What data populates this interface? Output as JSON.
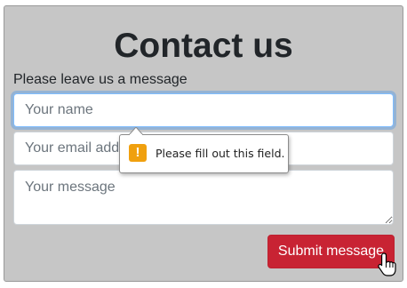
{
  "form": {
    "title": "Contact us",
    "subtitle": "Please leave us a message",
    "name_placeholder": "Your name",
    "email_placeholder": "Your email address",
    "message_placeholder": "Your message",
    "submit_label": "Submit message"
  },
  "validation_tooltip": {
    "icon": "warning-icon",
    "icon_glyph": "!",
    "message": "Please fill out this field."
  },
  "colors": {
    "panel_background": "#c6c6c6",
    "submit_button": "#c82333",
    "focus_ring": "#80bdff",
    "warning": "#f0a00e"
  }
}
